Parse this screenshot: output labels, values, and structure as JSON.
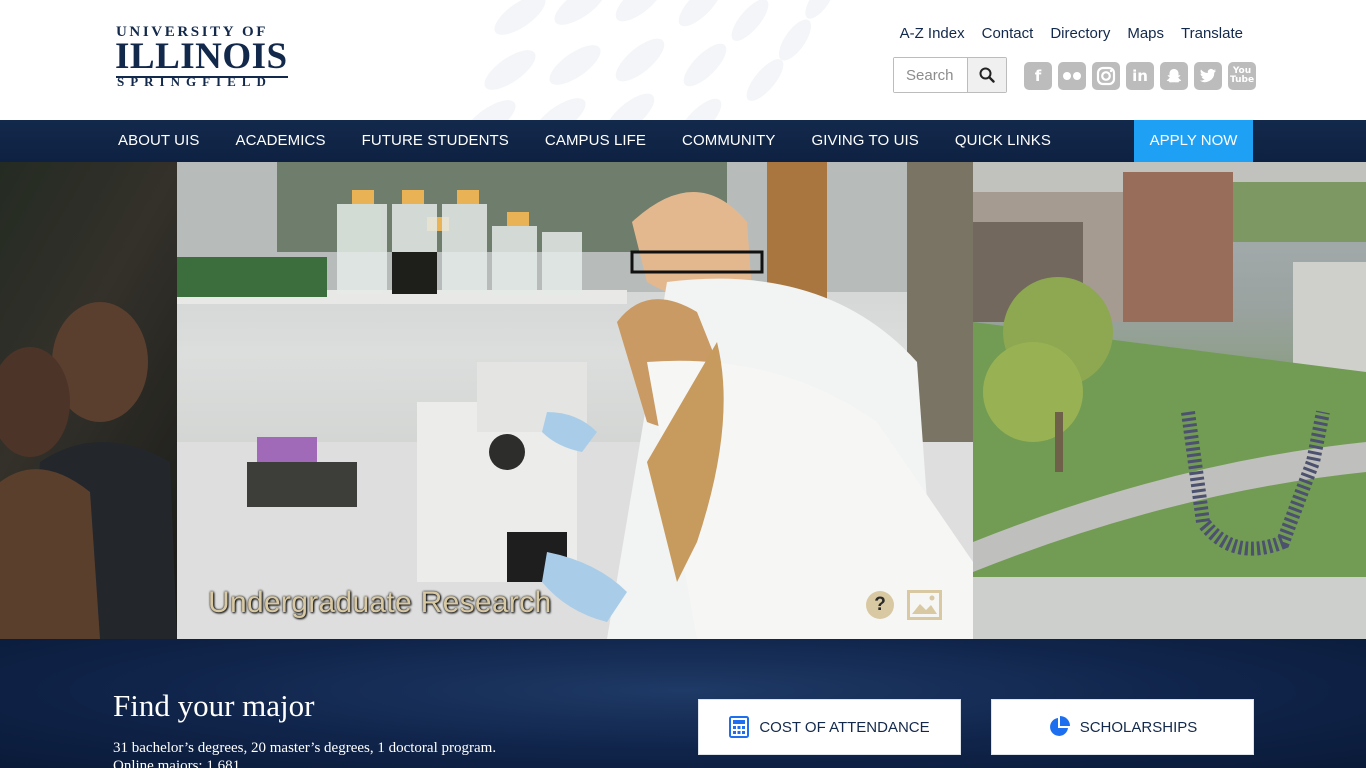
{
  "logo": {
    "line1": "UNIVERSITY OF",
    "line2": "ILLINOIS",
    "line3": "SPRINGFIELD"
  },
  "utility_links": [
    "A-Z Index",
    "Contact",
    "Directory",
    "Maps",
    "Translate"
  ],
  "search": {
    "placeholder": "Search"
  },
  "social_icons": [
    "facebook-icon",
    "flickr-icon",
    "instagram-icon",
    "linkedin-icon",
    "snapchat-icon",
    "twitter-icon",
    "youtube-icon"
  ],
  "nav": {
    "items": [
      "ABOUT UIS",
      "ACADEMICS",
      "FUTURE STUDENTS",
      "CAMPUS LIFE",
      "COMMUNITY",
      "GIVING TO UIS",
      "QUICK LINKS"
    ],
    "apply": "APPLY NOW"
  },
  "hero": {
    "caption": "Undergraduate Research",
    "help": "?"
  },
  "major": {
    "title": "Find your major",
    "desc_line1": "31 bachelor’s degrees, 20 master’s degrees, 1 doctoral program.",
    "desc_line2": "Online majors: 1,681"
  },
  "cta": {
    "cost": "COST OF ATTENDANCE",
    "scholarships": "SCHOLARSHIPS"
  },
  "colors": {
    "navy": "#13294b",
    "apply_blue": "#1ea0f5",
    "cta_icon_blue": "#1e6ff0",
    "social_gray": "#bcbcbc",
    "caption_tan": "#d8c9a3"
  }
}
